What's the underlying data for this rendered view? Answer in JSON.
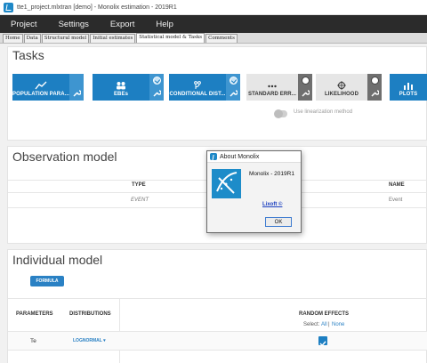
{
  "window": {
    "title": "tte1_project.mlxtran [demo] - Monolix estimation - 2019R1"
  },
  "menu": [
    "Project",
    "Settings",
    "Export",
    "Help"
  ],
  "tabs": [
    "Home",
    "Data",
    "Structural model",
    "Initial estimates",
    "Statistical model & Tasks",
    "Comments"
  ],
  "tasks_panel": {
    "title": "Tasks",
    "tasks": [
      {
        "label": "POPULATION PARA...",
        "icon": "chart-line-icon",
        "status": "none"
      },
      {
        "label": "EBEs",
        "icon": "people-icon",
        "status": "checked"
      },
      {
        "label": "CONDITIONAL DIST...",
        "icon": "branch-icon",
        "status": "checked"
      },
      {
        "label": "STANDARD ERR...",
        "icon": "dots-icon",
        "status": "unchecked"
      },
      {
        "label": "LIKELIHOOD",
        "icon": "crosshair-icon",
        "status": "unchecked"
      },
      {
        "label": "PLOTS",
        "icon": "bar-chart-icon",
        "status": "none"
      }
    ],
    "linearization_label": "Use linearization method"
  },
  "observation_panel": {
    "title": "Observation model",
    "headers": {
      "type": "TYPE",
      "name": "NAME"
    },
    "row": {
      "type": "EVENT",
      "name": "Event"
    }
  },
  "individual_panel": {
    "title": "Individual model",
    "formula_button": "FORMULA",
    "headers": {
      "parameters": "PARAMETERS",
      "distributions": "DISTRIBUTIONS",
      "random_effects": "RANDOM EFFECTS"
    },
    "select_label": "Select:",
    "select_all": "All",
    "select_sep": "|",
    "select_none": "None",
    "row": {
      "parameter": "Te",
      "distribution": "LOGNORMAL"
    }
  },
  "dialog": {
    "title": "About Monolix",
    "product": "Monolix - 2019R1",
    "link": "Lixoft ©",
    "ok": "OK"
  },
  "colors": {
    "accent": "#1d7fc2",
    "menubar": "#2b2b2b"
  }
}
